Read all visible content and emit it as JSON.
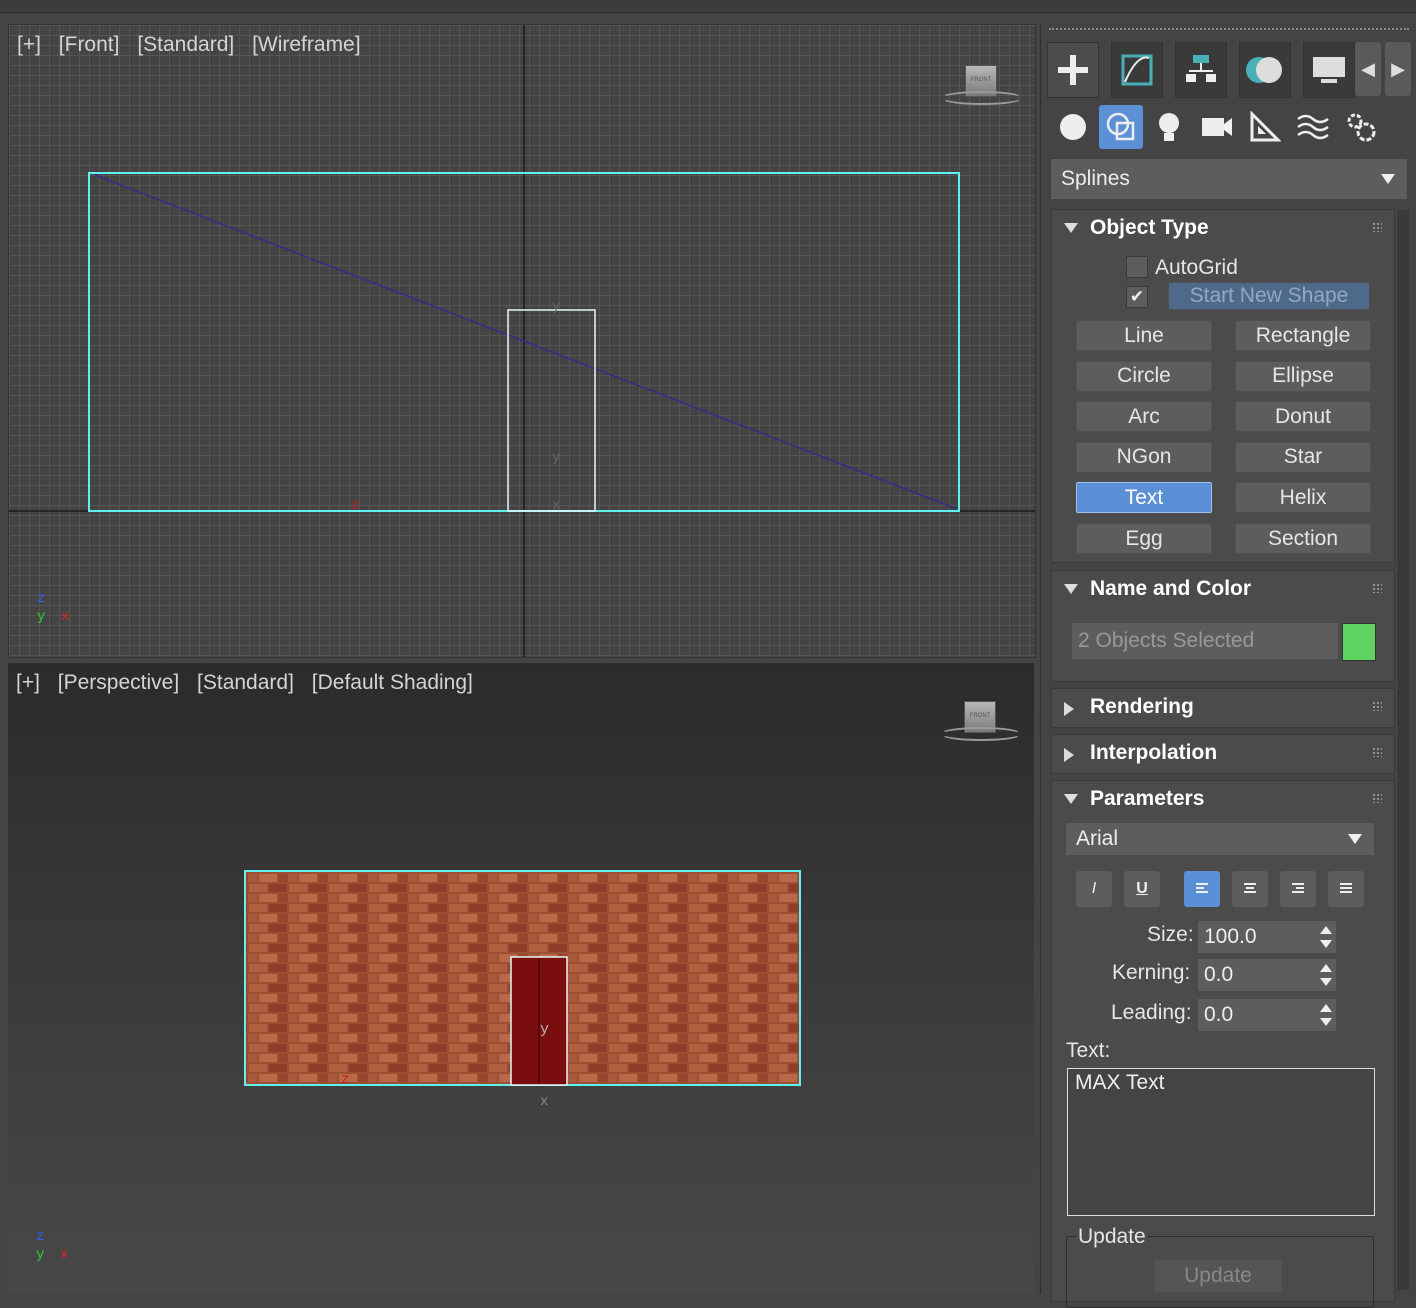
{
  "viewports": {
    "front": {
      "plus": "[+]",
      "name": "[Front]",
      "standard": "[Standard]",
      "shading": "[Wireframe]",
      "cube_label": "FRONT"
    },
    "perspective": {
      "plus": "[+]",
      "name": "[Perspective]",
      "standard": "[Standard]",
      "shading": "[Default Shading]",
      "cube_label": "FRONT"
    },
    "axis": {
      "z": "z",
      "y": "y",
      "x": "x"
    }
  },
  "command_panel": {
    "tabs": [
      "create-icon",
      "modify-icon",
      "hierarchy-icon",
      "motion-icon",
      "display-icon"
    ],
    "categories": [
      "geometry-icon",
      "shapes-icon",
      "lights-icon",
      "cameras-icon",
      "helpers-icon",
      "spacewarps-icon",
      "systems-icon"
    ],
    "category_dropdown": "Splines",
    "object_type": {
      "title": "Object Type",
      "autogrid": "AutoGrid",
      "start_new_shape": "Start New Shape",
      "start_new_shape_checked": true,
      "buttons": [
        "Line",
        "Rectangle",
        "Circle",
        "Ellipse",
        "Arc",
        "Donut",
        "NGon",
        "Star",
        "Text",
        "Helix",
        "Egg",
        "Section"
      ],
      "active_button": "Text"
    },
    "name_and_color": {
      "title": "Name and Color",
      "name_value": "2 Objects Selected",
      "color": "#5fd35f"
    },
    "rendering": {
      "title": "Rendering"
    },
    "interpolation": {
      "title": "Interpolation"
    },
    "parameters": {
      "title": "Parameters",
      "font": "Arial",
      "italic": "I",
      "underline": "U",
      "size_label": "Size:",
      "size": "100.0",
      "kerning_label": "Kerning:",
      "kerning": "0.0",
      "leading_label": "Leading:",
      "leading": "0.0",
      "text_label": "Text:",
      "text_value": "MAX Text",
      "update_group": "Update",
      "update_button": "Update"
    }
  },
  "colors": {
    "selection": "#5ff0f0",
    "accent": "#5b8fd6",
    "door": "#7a0d0d",
    "brick": "#a8563a"
  }
}
